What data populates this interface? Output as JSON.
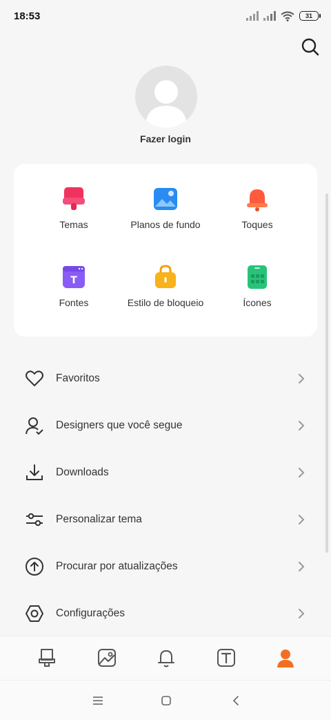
{
  "status": {
    "time": "18:53",
    "battery": "31"
  },
  "profile": {
    "login_label": "Fazer login"
  },
  "categories": [
    {
      "label": "Temas",
      "icon": "themes-icon",
      "color": "#f0325f"
    },
    {
      "label": "Planos de fundo",
      "icon": "wallpaper-icon",
      "color": "#2a8cf0"
    },
    {
      "label": "Toques",
      "icon": "bell-icon",
      "color": "#ff5a3c"
    },
    {
      "label": "Fontes",
      "icon": "font-icon",
      "color": "#8a5cf5"
    },
    {
      "label": "Estilo de bloqueio",
      "icon": "lock-style-icon",
      "color": "#f7b21c"
    },
    {
      "label": "Ícones",
      "icon": "icons-grid-icon",
      "color": "#28c37a"
    }
  ],
  "menu": [
    {
      "label": "Favoritos",
      "icon": "heart-icon"
    },
    {
      "label": "Designers que você segue",
      "icon": "user-check-icon"
    },
    {
      "label": "Downloads",
      "icon": "download-icon"
    },
    {
      "label": "Personalizar tema",
      "icon": "sliders-icon"
    },
    {
      "label": "Procurar por atualizações",
      "icon": "arrow-up-circle-icon"
    },
    {
      "label": "Configurações",
      "icon": "settings-icon"
    }
  ],
  "tabs": [
    {
      "icon": "themes-tab-icon",
      "active": false
    },
    {
      "icon": "wallpaper-tab-icon",
      "active": false
    },
    {
      "icon": "ringtone-tab-icon",
      "active": false
    },
    {
      "icon": "font-tab-icon",
      "active": false
    },
    {
      "icon": "profile-tab-icon",
      "active": true
    }
  ],
  "colors": {
    "accent": "#f26f21",
    "icon_gray": "#555555",
    "text": "#333333"
  }
}
